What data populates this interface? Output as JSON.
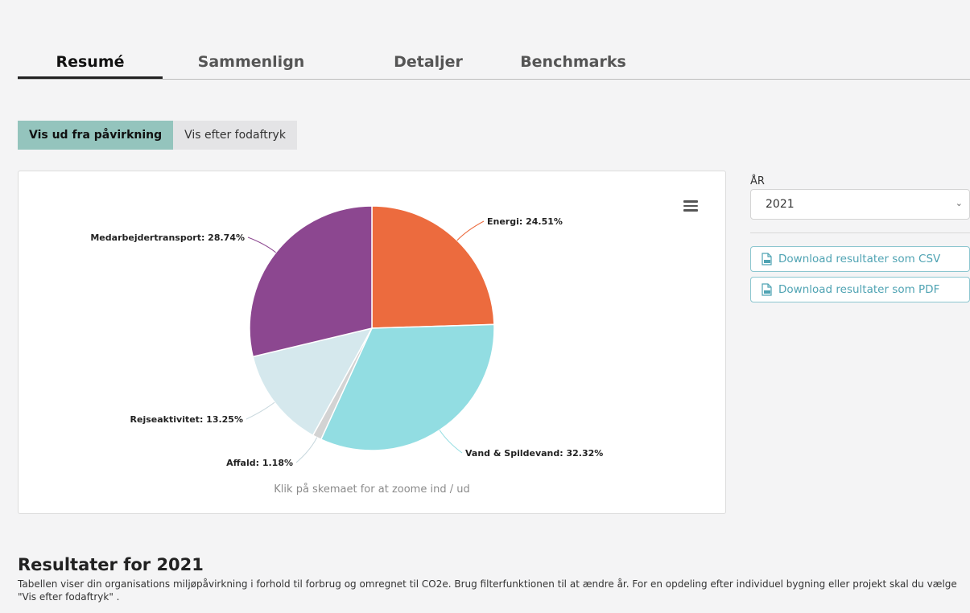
{
  "tabs": [
    {
      "label": "Resumé",
      "active": true
    },
    {
      "label": "Sammenlign",
      "active": false
    },
    {
      "label": "Detaljer",
      "active": false
    },
    {
      "label": "Benchmarks",
      "active": false
    }
  ],
  "view_toggle": {
    "impact_label": "Vis ud fra påvirkning",
    "footprint_label": "Vis efter fodaftryk",
    "selected": "impact"
  },
  "chart_data": {
    "type": "pie",
    "slices": [
      {
        "label": "Energi",
        "value": 24.51,
        "display": "Energi: 24.51%",
        "color": "#ec6b3e"
      },
      {
        "label": "Vand & Spildevand",
        "value": 32.32,
        "display": "Vand & Spildevand: 32.32%",
        "color": "#92dde2"
      },
      {
        "label": "Affald",
        "value": 1.18,
        "display": "Affald: 1.18%",
        "color": "#d3d3d3"
      },
      {
        "label": "Rejseaktivitet",
        "value": 13.25,
        "display": "Rejseaktivitet: 13.25%",
        "color": "#d5e8ed"
      },
      {
        "label": "Medarbejdertransport",
        "value": 28.74,
        "display": "Medarbejdertransport: 28.74%",
        "color": "#8c4790"
      }
    ],
    "hint": "Klik på skemaet for at zoome ind / ud"
  },
  "year_filter": {
    "label": "ÅR",
    "value": "2021"
  },
  "downloads": {
    "csv_label": "Download resultater som CSV",
    "pdf_label": "Download resultater som PDF"
  },
  "results": {
    "title": "Resultater for 2021",
    "description": "Tabellen viser din organisations miljøpåvirkning i forhold til forbrug og omregnet til CO2e. Brug filterfunktionen til at ændre år. For en opdeling efter individuel bygning eller projekt skal du vælge \"Vis efter fodaftryk\" ."
  },
  "colors": {
    "accent": "#94c4bd",
    "download_border": "#8cc6cf",
    "download_text": "#4fa3b3"
  }
}
